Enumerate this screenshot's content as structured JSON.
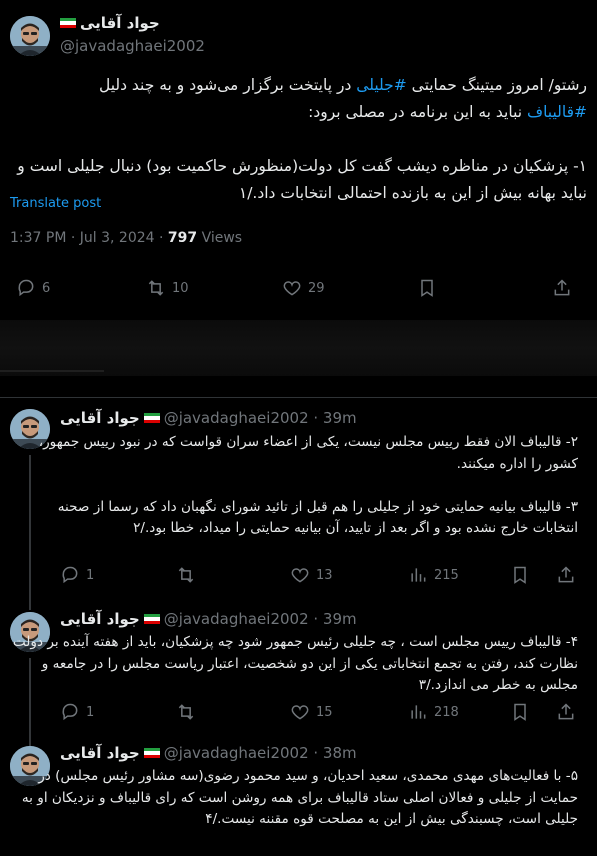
{
  "main": {
    "name": "جواد آقایی",
    "handle": "@javadaghaei2002",
    "text_part1": "رشتو/ امروز میتینگ حمایتی ",
    "hashtag1": "#جلیلی",
    "text_part2": " در پایتخت برگزار می‌شود و به چند دلیل\n",
    "hashtag2": "#قالیباف",
    "text_part3": " نباید به این برنامه در مصلی برود:\n\n۱- پزشکیان در مناظره دیشب گفت کل دولت(منظورش حاکمیت بود) دنبال جلیلی است و نباید بهانه بیش از این به بازنده احتمالی انتخابات داد./۱",
    "translate": "Translate post",
    "time": "1:37 PM · Jul 3, 2024 · ",
    "views_count": "797",
    "views_label": " Views",
    "replies": "6",
    "retweets": "10",
    "likes": "29"
  },
  "replies": [
    {
      "name": "جواد آقایی",
      "handle": "@javadaghaei2002 · 39m",
      "text": "۲- قالیباف الان فقط رییس مجلس نیست، یکی از اعضاء سران قواست که در نبود رییس جمهور، کشور را اداره میکنند.\n\n۳- قالیباف بیانیه حمایتی خود از جلیلی را هم قبل از تائید شورای نگهبان داد که رسما از صحنه انتخابات خارج نشده بود و اگر بعد از تایید، آن بیانیه حمایتی را میداد، خطا بود./۲",
      "replies": "1",
      "likes": "13",
      "views": "215"
    },
    {
      "name": "جواد آقایی",
      "handle": "@javadaghaei2002 · 39m",
      "text": "۴- قالیباف رییس مجلس است ، چه جلیلی رئیس جمهور شود چه پزشکیان، باید از هفته آینده بر دولت نظارت کند، رفتن به تجمع انتخاباتی یکی از این دو شخصیت، اعتبار ریاست مجلس را در جامعه و مجلس به خطر می اندازد./۳",
      "replies": "1",
      "likes": "15",
      "views": "218"
    },
    {
      "name": "جواد آقایی",
      "handle": "@javadaghaei2002 · 38m",
      "text": "۵- با فعالیت‌های مهدی محمدی، سعید احدیان، و سید محمود رضوی(سه مشاور رئیس مجلس) در حمایت از جلیلی و فعالان اصلی ستاد قالیباف برای همه روشن است که رای قالیباف و نزدیکان او به جلیلی است، چسبندگی بیش از این به مصلحت قوه مقننه نیست./۴"
    }
  ],
  "colors": {
    "accent": "#1d9bf0",
    "muted": "#71767b",
    "text": "#e7e9ea",
    "background": "#000000"
  }
}
